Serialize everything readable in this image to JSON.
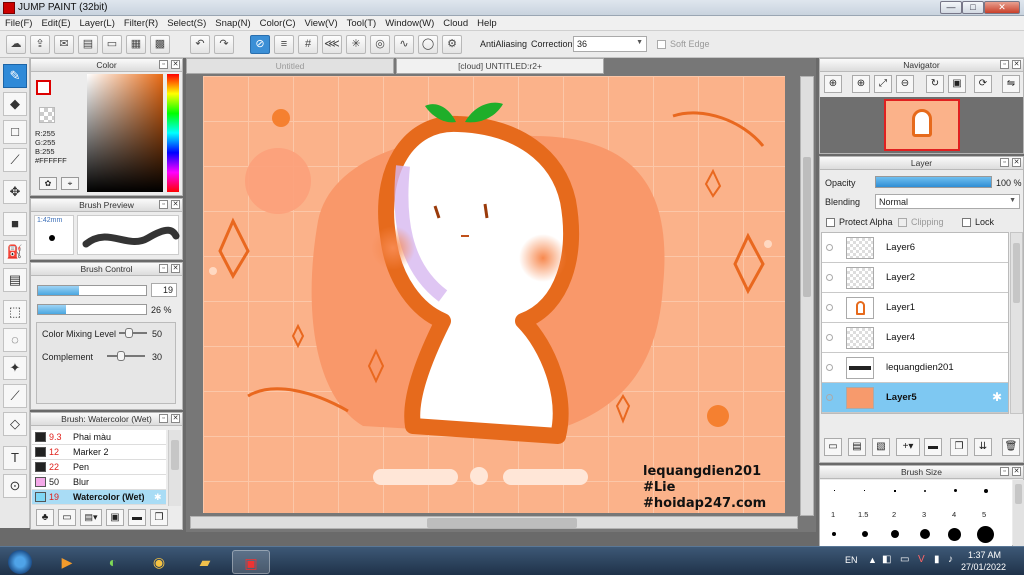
{
  "window": {
    "title": "JUMP PAINT (32bit)",
    "minimize": "—",
    "maximize": "□",
    "close": "✕"
  },
  "menu": [
    "File(F)",
    "Edit(E)",
    "Layer(L)",
    "Filter(R)",
    "Select(S)",
    "Snap(N)",
    "Color(C)",
    "View(V)",
    "Tool(T)",
    "Window(W)",
    "Cloud",
    "Help"
  ],
  "toolbar": {
    "antialiasing_label": "AntiAliasing",
    "antialiasing_checked": true,
    "correction_label": "Correction",
    "correction_value": "36",
    "softedge_label": "Soft Edge"
  },
  "color_panel": {
    "title": "Color",
    "r": "R:255",
    "g": "G:255",
    "b": "B:255",
    "hex": "#FFFFFF"
  },
  "brush_preview": {
    "title": "Brush Preview",
    "size": "1:42mm"
  },
  "brush_control": {
    "title": "Brush Control",
    "size_value": "19",
    "density_value": "26 %",
    "mixing_label": "Color Mixing Level",
    "mixing_value": "50",
    "complement_label": "Complement",
    "complement_value": "30"
  },
  "brush_list": {
    "title": "Brush: Watercolor (Wet)",
    "items": [
      {
        "num": "9.3",
        "name": "Phai màu",
        "color": "#222222"
      },
      {
        "num": "12",
        "name": "Marker 2",
        "color": "#222222"
      },
      {
        "num": "22",
        "name": "Pen",
        "color": "#222222"
      },
      {
        "num": "50",
        "name": "Blur",
        "color": "#f4a9e8"
      },
      {
        "num": "19",
        "name": "Watercolor (Wet)",
        "color": "#7fd7f5"
      }
    ]
  },
  "document": {
    "tab_inactive": "Untitled",
    "tab_active": "[cloud] UNTITLED:r2+"
  },
  "artwork": {
    "watermark_line1": "lequangdien201",
    "watermark_line2": "#Lie",
    "watermark_line3": "#hoidap247.com",
    "bg_color": "#fbb28a",
    "accent": "#e9681f"
  },
  "navigator": {
    "title": "Navigator"
  },
  "layer_panel": {
    "title": "Layer",
    "opacity_label": "Opacity",
    "opacity_value": "100 %",
    "opacity_fraction": 1.0,
    "blending_label": "Blending",
    "blending_value": "Normal",
    "protect_alpha": "Protect Alpha",
    "clipping": "Clipping",
    "lock": "Lock",
    "layers": [
      "Layer6",
      "Layer2",
      "Layer1",
      "Layer4",
      "lequangdien201",
      "Layer5"
    ],
    "selected_index": 5
  },
  "brush_size": {
    "title": "Brush Size",
    "labels": [
      "1",
      "1.5",
      "2",
      "3",
      "4",
      "5"
    ]
  },
  "taskbar": {
    "lang": "EN",
    "time": "1:37 AM",
    "date": "27/01/2022"
  }
}
